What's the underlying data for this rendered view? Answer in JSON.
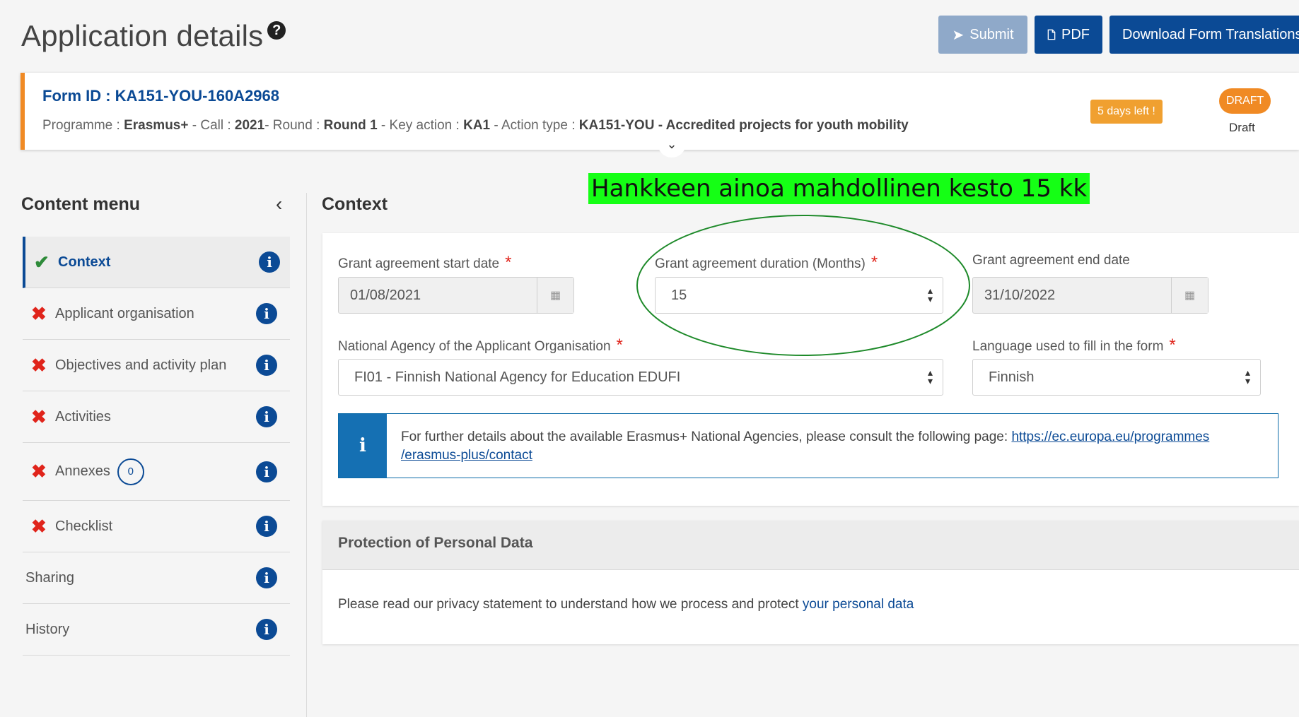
{
  "header": {
    "title": "Application details",
    "help_icon": "question-circle-icon",
    "buttons": {
      "submit": "Submit",
      "pdf": "PDF",
      "download": "Download Form Translations"
    }
  },
  "form": {
    "id_label": "Form ID : KA151-YOU-160A2968",
    "meta": {
      "programme_label": "Programme : ",
      "programme": "Erasmus+",
      "call_label": " - Call : ",
      "call": "2021",
      "round_label": "- Round : ",
      "round": "Round 1",
      "key_action_label": " - Key action : ",
      "key_action": "KA1",
      "action_type_label": " - Action type : ",
      "action_type": "KA151-YOU - Accredited projects for youth mobility"
    },
    "days_left": "5 days left !",
    "status_pill": "DRAFT",
    "status_text": "Draft"
  },
  "sidebar": {
    "title": "Content menu",
    "items": [
      {
        "label": "Context",
        "status": "ok"
      },
      {
        "label": "Applicant organisation",
        "status": "error"
      },
      {
        "label": "Objectives and activity plan",
        "status": "error"
      },
      {
        "label": "Activities",
        "status": "error"
      },
      {
        "label": "Annexes",
        "status": "error",
        "count": "0"
      },
      {
        "label": "Checklist",
        "status": "error"
      },
      {
        "label": "Sharing",
        "status": "none"
      },
      {
        "label": "History",
        "status": "none"
      }
    ]
  },
  "content": {
    "section_title": "Context",
    "annotation": "Hankkeen ainoa mahdollinen kesto 15 kk",
    "fields": {
      "start_date": {
        "label": "Grant agreement start date",
        "value": "01/08/2021"
      },
      "duration": {
        "label": "Grant agreement duration (Months)",
        "value": "15"
      },
      "end_date": {
        "label": "Grant agreement end date",
        "value": "31/10/2022"
      },
      "national_agency": {
        "label": "National Agency of the Applicant Organisation",
        "value": "FI01 - Finnish National Agency for Education EDUFI"
      },
      "language": {
        "label": "Language used to fill in the form",
        "value": "Finnish"
      }
    },
    "info_text": "For further details about the available Erasmus+ National Agencies, please consult the following page: ",
    "info_link_1": "https://ec.europa.eu/programmes",
    "info_link_2": "/erasmus-plus/contact",
    "privacy": {
      "title": "Protection of Personal Data",
      "text": "Please read our privacy statement to understand how we process and protect ",
      "link": "your personal data"
    }
  },
  "colors": {
    "primary": "#0b4a95",
    "accent": "#f08a24",
    "error": "#e0241b",
    "success": "#2e8b3a",
    "annotation_bg": "#15ff15"
  }
}
